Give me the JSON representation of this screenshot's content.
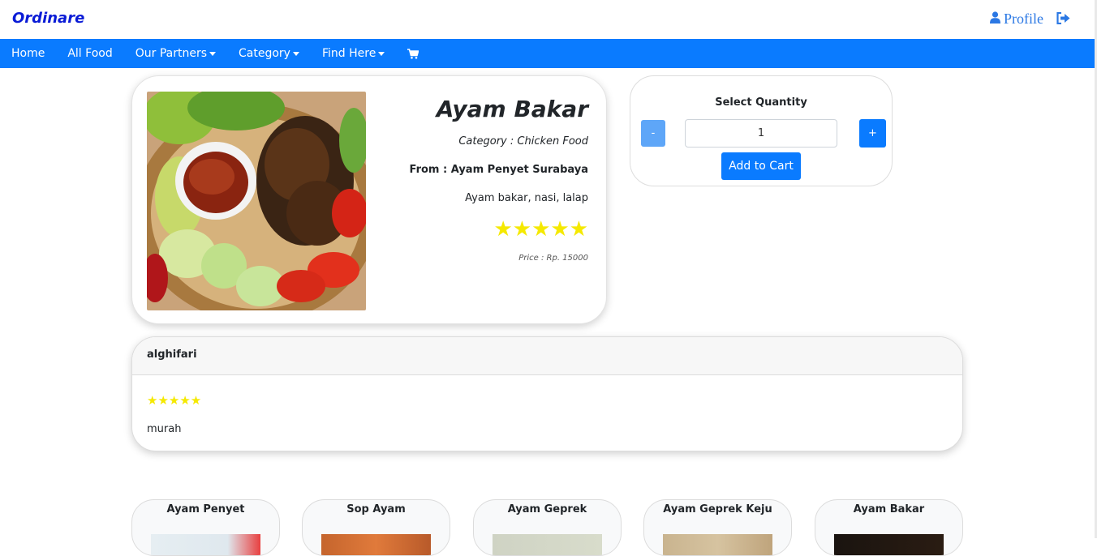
{
  "brand": "Ordinare",
  "profile_label": "Profile",
  "nav": {
    "items": [
      {
        "label": "Home",
        "dropdown": false
      },
      {
        "label": "All Food",
        "dropdown": false
      },
      {
        "label": "Our Partners",
        "dropdown": true
      },
      {
        "label": "Category",
        "dropdown": true
      },
      {
        "label": "Find Here",
        "dropdown": true
      }
    ]
  },
  "food": {
    "name": "Ayam Bakar",
    "category": "Category : Chicken Food",
    "from": "From : Ayam Penyet Surabaya",
    "description": "Ayam bakar, nasi, lalap",
    "rating": 5,
    "stars": "★★★★★",
    "price": "Price : Rp. 15000"
  },
  "quantity": {
    "title": "Select Quantity",
    "minus_label": "-",
    "value": "1",
    "plus_label": "+",
    "add_to_cart_label": "Add to Cart"
  },
  "review": {
    "user": "alghifari",
    "rating": 5,
    "stars": "★★★★★",
    "text": "murah"
  },
  "recommendations": [
    {
      "name": "Ayam Penyet"
    },
    {
      "name": "Sop Ayam"
    },
    {
      "name": "Ayam Geprek"
    },
    {
      "name": "Ayam Geprek Keju"
    },
    {
      "name": "Ayam Bakar"
    }
  ],
  "colors": {
    "brand": "#0a1bd6",
    "nav_bg": "#0a7bff",
    "star": "#f5e900",
    "link": "#2b78e4"
  }
}
